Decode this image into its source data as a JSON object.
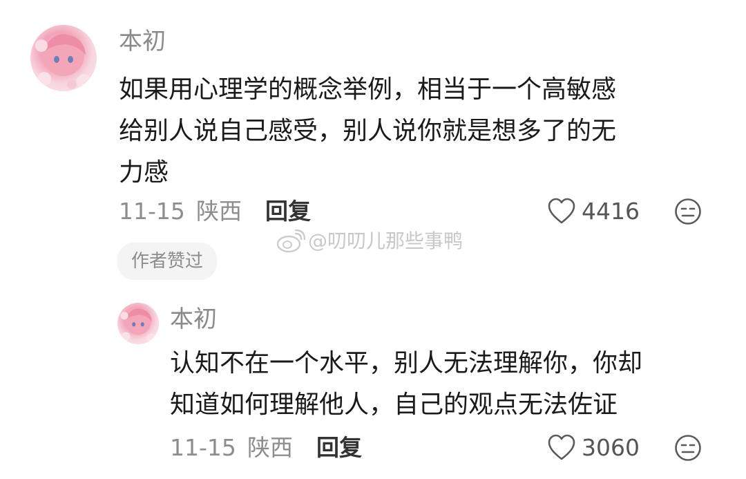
{
  "comments": [
    {
      "user_name": "本初",
      "text": [
        "如果用心理学的概念举例，相当于一个高敏感",
        "给别人说自己感受，别人说你就是想多了的无",
        "力感"
      ],
      "date": "11-15",
      "location": "陕西",
      "reply_label": "回复",
      "like_count": "4416",
      "badge": "作者赞过"
    },
    {
      "user_name": "本初",
      "text": [
        "认知不在一个水平，别人无法理解你，你却",
        "知道如何理解他人，自己的观点无法佐证"
      ],
      "date": "11-15",
      "location": "陕西",
      "reply_label": "回复",
      "like_count": "3060"
    }
  ],
  "watermark": "@叨叨儿那些事鸭",
  "icons": {
    "like": "heart-outline-icon",
    "dislike": "neutral-face-icon",
    "watermark": "weibo-logo-icon"
  },
  "colors": {
    "text": "#1a1a1a",
    "meta": "#8d8d8d",
    "badge_bg": "#f4f4f4"
  }
}
